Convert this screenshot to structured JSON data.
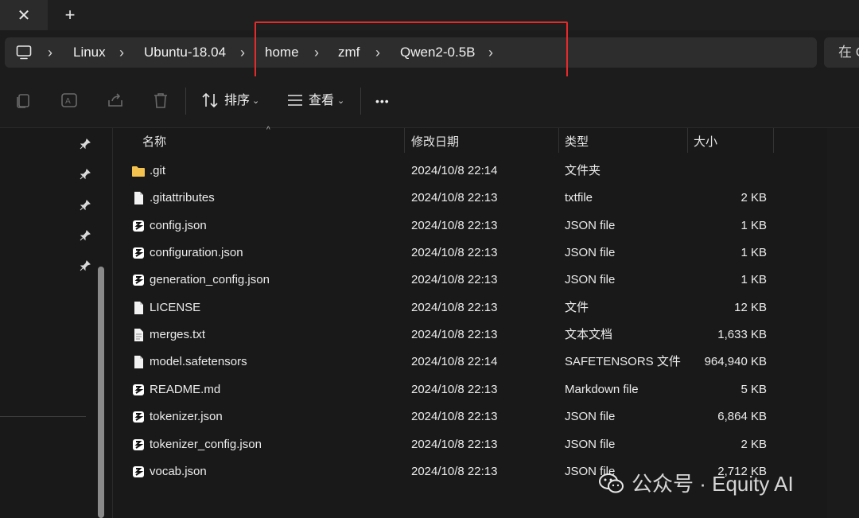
{
  "tabbar": {
    "close_glyph": "✕",
    "new_tab_glyph": "+"
  },
  "breadcrumb": {
    "root_icon": "computer-icon",
    "items": [
      "Linux",
      "Ubuntu-18.04",
      "home",
      "zmf",
      "Qwen2-0.5B"
    ],
    "separator": "›",
    "search_partial": "在 C"
  },
  "toolbar": {
    "icons": [
      "copy-icon",
      "rename-icon",
      "share-icon",
      "delete-icon"
    ],
    "sort_label": "排序",
    "view_label": "查看",
    "more_label": "•••"
  },
  "nav": {
    "pinned_count": 5,
    "pin_icon": "pin-icon"
  },
  "columns": {
    "name": "名称",
    "modified": "修改日期",
    "type": "类型",
    "size": "大小"
  },
  "files": [
    {
      "name": ".git",
      "modified": "2024/10/8 22:14",
      "type": "文件夹",
      "size": "",
      "icon": "folder-icon"
    },
    {
      "name": ".gitattributes",
      "modified": "2024/10/8 22:13",
      "type": "txtfile",
      "size": "2 KB",
      "icon": "file-icon"
    },
    {
      "name": "config.json",
      "modified": "2024/10/8 22:13",
      "type": "JSON file",
      "size": "1 KB",
      "icon": "json-file-icon"
    },
    {
      "name": "configuration.json",
      "modified": "2024/10/8 22:13",
      "type": "JSON file",
      "size": "1 KB",
      "icon": "json-file-icon"
    },
    {
      "name": "generation_config.json",
      "modified": "2024/10/8 22:13",
      "type": "JSON file",
      "size": "1 KB",
      "icon": "json-file-icon"
    },
    {
      "name": "LICENSE",
      "modified": "2024/10/8 22:13",
      "type": "文件",
      "size": "12 KB",
      "icon": "file-icon"
    },
    {
      "name": "merges.txt",
      "modified": "2024/10/8 22:13",
      "type": "文本文档",
      "size": "1,633 KB",
      "icon": "text-file-icon"
    },
    {
      "name": "model.safetensors",
      "modified": "2024/10/8 22:14",
      "type": "SAFETENSORS 文件",
      "size": "964,940 KB",
      "icon": "file-icon"
    },
    {
      "name": "README.md",
      "modified": "2024/10/8 22:13",
      "type": "Markdown file",
      "size": "5 KB",
      "icon": "json-file-icon"
    },
    {
      "name": "tokenizer.json",
      "modified": "2024/10/8 22:13",
      "type": "JSON file",
      "size": "6,864 KB",
      "icon": "json-file-icon"
    },
    {
      "name": "tokenizer_config.json",
      "modified": "2024/10/8 22:13",
      "type": "JSON file",
      "size": "2 KB",
      "icon": "json-file-icon"
    },
    {
      "name": "vocab.json",
      "modified": "2024/10/8 22:13",
      "type": "JSON file",
      "size": "2,712 KB",
      "icon": "json-file-icon"
    }
  ],
  "watermark": {
    "text": "公众号 · Equity AI",
    "logo": "wechat-logo"
  },
  "colors": {
    "highlight": "#e52a2a",
    "folder": "#f3c24f",
    "background": "#191919"
  }
}
